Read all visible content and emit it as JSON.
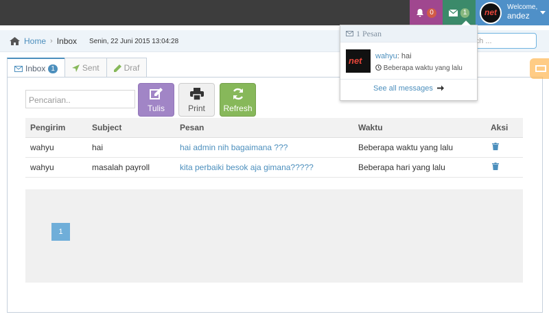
{
  "navbar": {
    "notifications_count": "0",
    "messages_count": "1",
    "welcome_label": "Welcome,",
    "username": "andez",
    "bell_color": "#a0478f",
    "mail_color": "#3b8a6a",
    "user_color": "#4f90c8"
  },
  "breadcrumb": {
    "home": "Home",
    "current": "Inbox",
    "datetime": "Senin, 22 Juni 2015 13:04:28"
  },
  "nav_search": {
    "placeholder": "rch ..."
  },
  "tabs": [
    {
      "label": "Inbox",
      "badge": "1",
      "active": true
    },
    {
      "label": "Sent"
    },
    {
      "label": "Draf"
    }
  ],
  "toolbar": {
    "search_placeholder": "Pencarian..",
    "tulis_label": "Tulis",
    "print_label": "Print",
    "refresh_label": "Refresh"
  },
  "table": {
    "headers": [
      "Pengirim",
      "Subject",
      "Pesan",
      "Waktu",
      "Aksi"
    ],
    "rows": [
      {
        "pengirim": "wahyu",
        "subject": "hai",
        "pesan": "hai admin nih bagaimana ???",
        "waktu": "Beberapa waktu yang lalu"
      },
      {
        "pengirim": "wahyu",
        "subject": "masalah payroll",
        "pesan": "kita perbaiki besok aja gimana?????",
        "waktu": "Beberapa hari yang lalu"
      }
    ]
  },
  "pagination": {
    "current": "1"
  },
  "dropdown": {
    "header": "1 Pesan",
    "item_sender": "wahyu",
    "item_text": ": hai",
    "item_time": "Beberapa waktu yang lalu",
    "footer": "See all messages"
  },
  "logo_text": "net"
}
